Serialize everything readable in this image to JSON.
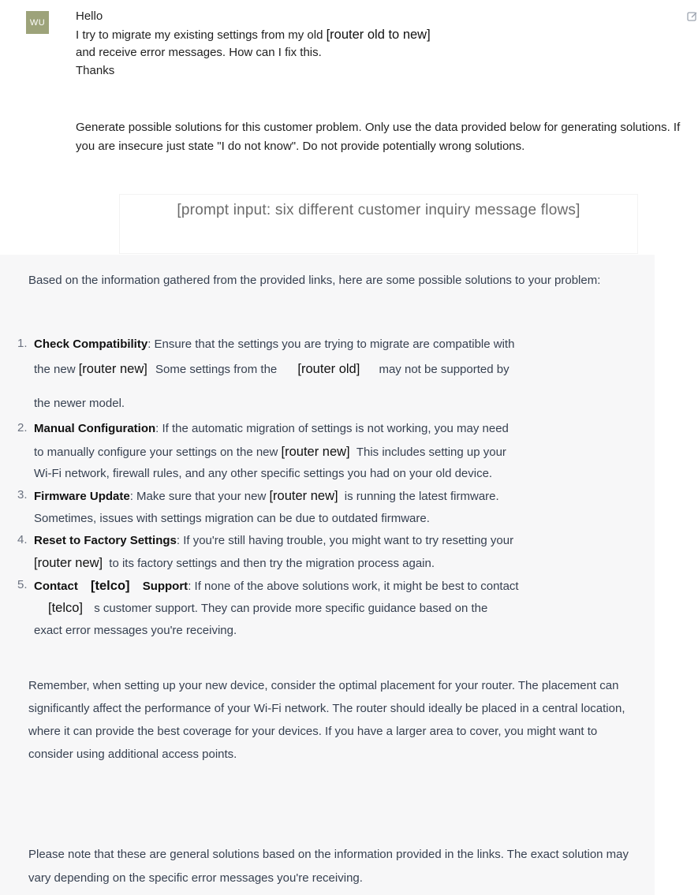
{
  "user": {
    "avatar": "WU",
    "greeting": "Hello",
    "line1_prefix": "I try to migrate my existing settings from my old ",
    "line1_placeholder": "[router old to new]",
    "line2": "and receive error messages. How can I fix this.",
    "line3": "Thanks",
    "instruction": "Generate possible solutions for this customer problem. Only use the data provided below for generating solutions. If you are insecure just state \"I do not know\". Do not provide potentially wrong solutions.",
    "prompt_input": "[prompt input: six different customer inquiry message flows]"
  },
  "assistant": {
    "intro": "Based on the information gathered from the provided links, here are some possible solutions to your problem:",
    "items": [
      {
        "num": "1.",
        "title": "Check Compatibility",
        "l1": ": Ensure that the settings you are trying to migrate are compatible with",
        "l2a": "the new ",
        "ph1": "[router new]",
        "l2b": "Some settings from the",
        "ph2": "[router old]",
        "l2c": "may not be supported by",
        "l3": "the newer model."
      },
      {
        "num": "2.",
        "title": "Manual Configuration",
        "l1": ": If the automatic migration of settings is not working, you may need",
        "l2a": "to manually configure your settings on the new ",
        "ph1": "[router new]",
        "l2b": "This includes setting up your",
        "l3": "Wi-Fi network, firewall rules, and any other specific settings you had on your old device."
      },
      {
        "num": "3.",
        "title": "Firmware Update",
        "l1a": ": Make sure that your new ",
        "ph1": "[router new]",
        "l1b": "is running the latest firmware.",
        "l2": "Sometimes, issues with settings migration can be due to outdated firmware."
      },
      {
        "num": "4.",
        "title": "Reset to Factory Settings",
        "l1": ": If you're still having trouble, you might want to try resetting your",
        "ph1": "[router new]",
        "l2": "to its factory settings and then try the migration process again."
      },
      {
        "num": "5.",
        "title_a": "Contact",
        "ph_title": "[telco]",
        "title_b": "Support",
        "l1": ": If none of the above solutions work, it might be best to contact",
        "ph1": "[telco]",
        "l2": "s customer support. They can provide more specific guidance based on the",
        "l3": "exact error messages you're receiving."
      }
    ],
    "remember": "Remember, when setting up your new device, consider the optimal placement for your router. The placement can significantly affect the performance of your Wi-Fi network. The router should ideally be placed in a central location, where it can provide the best coverage for your devices. If you have a larger area to cover, you might want to consider using additional access points.",
    "note": "Please note that these are general solutions based on the information provided in the links. The exact solution may vary depending on the specific error messages you're receiving."
  }
}
